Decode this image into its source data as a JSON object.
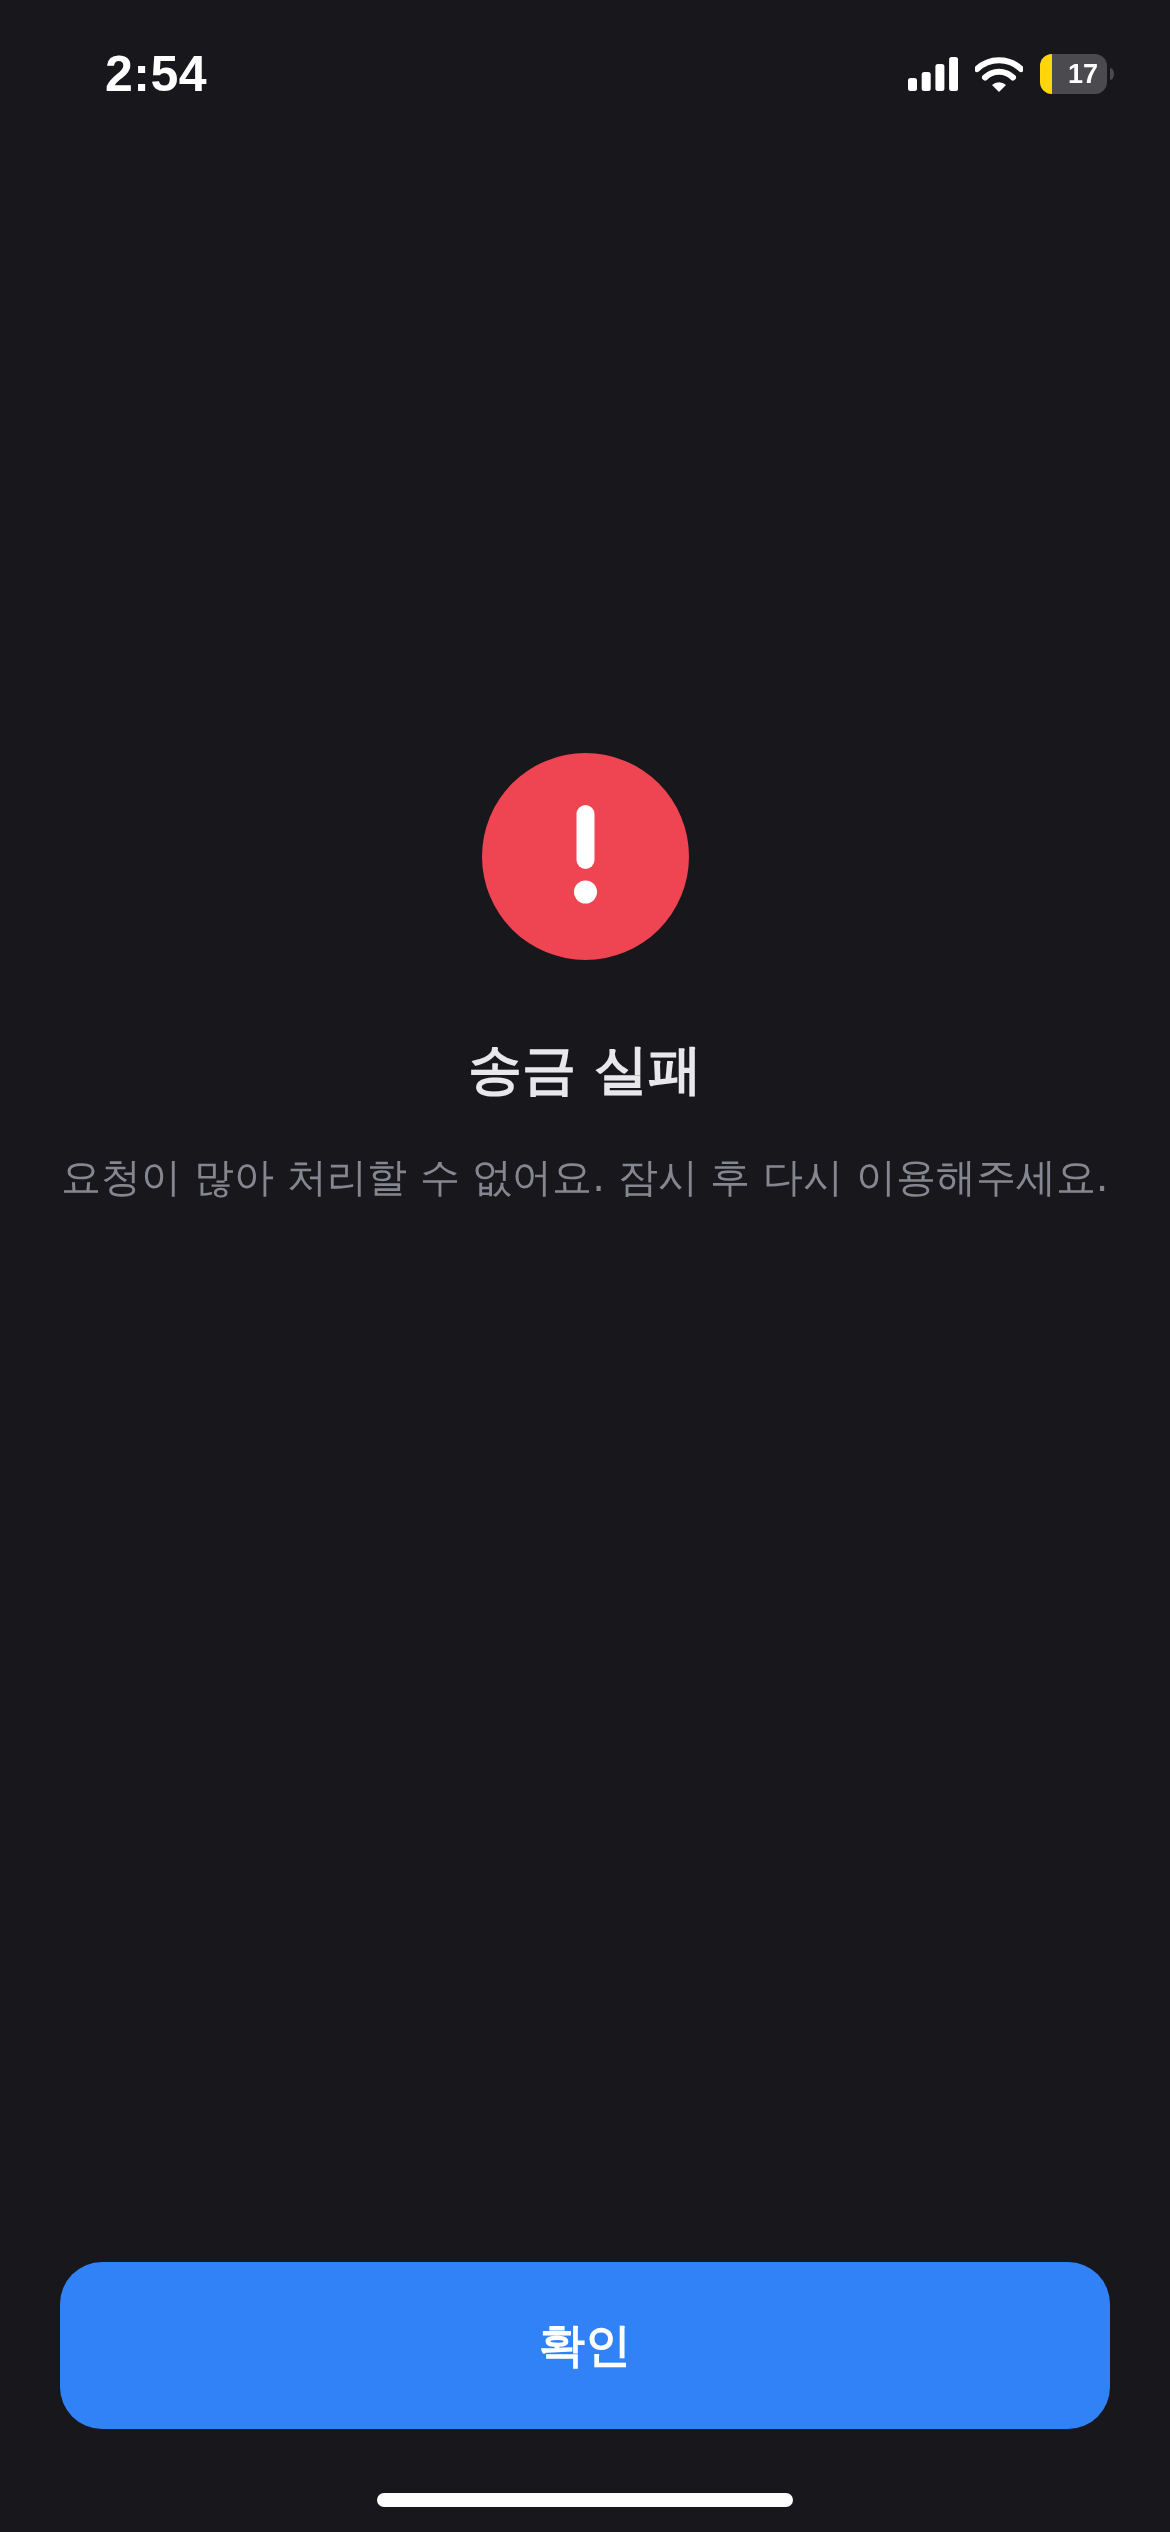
{
  "status_bar": {
    "time": "2:54",
    "battery": {
      "percent": "17",
      "low_power_mode": true
    }
  },
  "alert": {
    "kind": "error",
    "title": "송금 실패",
    "message": "요청이 많아 처리할 수 없어요. 잠시 후 다시 이용해주세요."
  },
  "buttons": [
    {
      "label": "확인"
    }
  ]
}
